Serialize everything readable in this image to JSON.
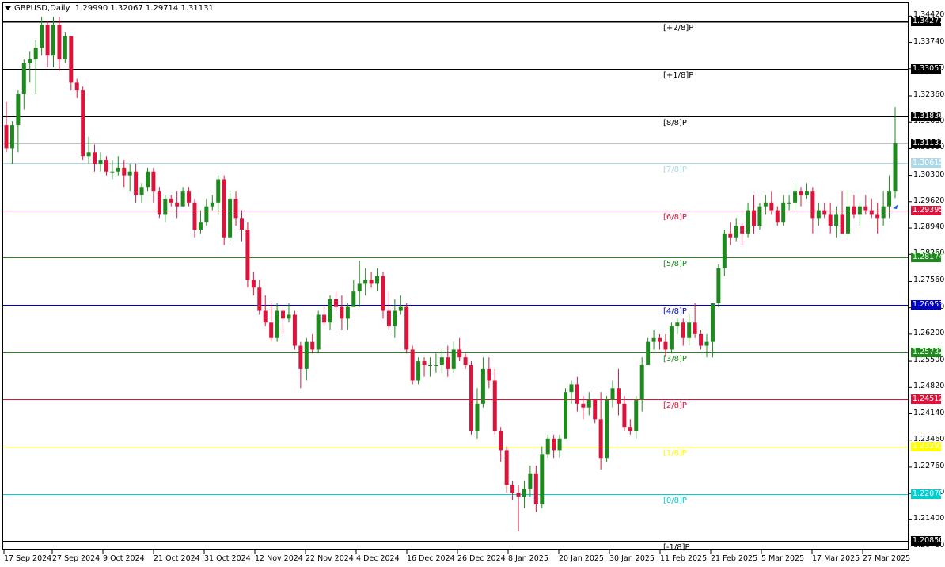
{
  "title": {
    "symbol_text": "GBPUSD,Daily",
    "ohlc_text": "1.29990 1.32067 1.29714 1.31131"
  },
  "colors": {
    "bull": "#1e8a1e",
    "bear": "#dc143c",
    "background": "#ffffff"
  },
  "price_ticks": [
    "1.34420",
    "1.33740",
    "1.33060",
    "1.32360",
    "1.31680",
    "1.31000",
    "1.30300",
    "1.29620",
    "1.28940",
    "1.28260",
    "1.27560",
    "1.26880",
    "1.26200",
    "1.25500",
    "1.24820",
    "1.24140",
    "1.23460",
    "1.22760",
    "1.22080",
    "1.21400",
    "1.20720"
  ],
  "date_ticks": [
    "17 Sep 2024",
    "27 Sep 2024",
    "9 Oct 2024",
    "21 Oct 2024",
    "31 Oct 2024",
    "12 Nov 2024",
    "22 Nov 2024",
    "4 Dec 2024",
    "16 Dec 2024",
    "26 Dec 2024",
    "8 Jan 2025",
    "20 Jan 2025",
    "30 Jan 2025",
    "11 Feb 2025",
    "21 Feb 2025",
    "5 Mar 2025",
    "17 Mar 2025",
    "27 Mar 2025"
  ],
  "levels": [
    {
      "label": "[+2/8]P",
      "price": "1.34277",
      "color": "#000000",
      "box_bg": "#000000",
      "box_fg": "#ffffff",
      "width": 2
    },
    {
      "label": "[+1/8]P",
      "price": "1.33057",
      "color": "#000000",
      "box_bg": "#000000",
      "box_fg": "#ffffff",
      "width": 1
    },
    {
      "label": "[8/8]P",
      "price": "1.31836",
      "color": "#000000",
      "box_bg": "#000000",
      "box_fg": "#ffffff",
      "width": 1
    },
    {
      "label": "[7/8]P",
      "price": "1.30615",
      "color": "#add8e6",
      "box_bg": "#add8e6",
      "box_fg": "#ffffff",
      "width": 1
    },
    {
      "label": "[6/8]P",
      "price": "1.29395",
      "color": "#dc143c",
      "box_bg": "#dc143c",
      "box_fg": "#ffffff",
      "width": 1
    },
    {
      "label": "[5/8]P",
      "price": "1.28174",
      "color": "#1e8a1e",
      "box_bg": "#1e8a1e",
      "box_fg": "#ffffff",
      "width": 1
    },
    {
      "label": "[4/8]P",
      "price": "1.26953",
      "color": "#0000cd",
      "box_bg": "#0000cd",
      "box_fg": "#ffffff",
      "width": 1
    },
    {
      "label": "[3/8]P",
      "price": "1.25732",
      "color": "#1e8a1e",
      "box_bg": "#1e8a1e",
      "box_fg": "#ffffff",
      "width": 1
    },
    {
      "label": "[2/8]P",
      "price": "1.24512",
      "color": "#dc143c",
      "box_bg": "#dc143c",
      "box_fg": "#ffffff",
      "width": 1
    },
    {
      "label": "[1/8]P",
      "price": "1.23291",
      "color": "#ffff00",
      "box_bg": "#ffff00",
      "box_fg": "#ffffff",
      "width": 1
    },
    {
      "label": "[0/8]P",
      "price": "1.22070",
      "color": "#00ced1",
      "box_bg": "#00ced1",
      "box_fg": "#ffffff",
      "width": 1
    },
    {
      "label": "[-1/8]P",
      "price": "1.20850",
      "color": "#000000",
      "box_bg": "#000000",
      "box_fg": "#ffffff",
      "width": 1
    }
  ],
  "current_price": {
    "value": "1.31131",
    "line_color": "#c0c0c0",
    "box_bg": "#000000",
    "box_fg": "#ffffff"
  },
  "chart_data": {
    "type": "candlestick",
    "title": "GBPUSD,Daily",
    "ylim": [
      1.2065,
      1.3455
    ],
    "candles": [
      [
        1.316,
        1.322,
        1.309,
        1.31
      ],
      [
        1.31,
        1.317,
        1.306,
        1.316
      ],
      [
        1.316,
        1.325,
        1.309,
        1.324
      ],
      [
        1.324,
        1.333,
        1.32,
        1.332
      ],
      [
        1.332,
        1.335,
        1.327,
        1.333
      ],
      [
        1.333,
        1.338,
        1.324,
        1.336
      ],
      [
        1.336,
        1.344,
        1.334,
        1.342
      ],
      [
        1.342,
        1.343,
        1.331,
        1.334
      ],
      [
        1.334,
        1.344,
        1.331,
        1.342
      ],
      [
        1.342,
        1.344,
        1.33,
        1.333
      ],
      [
        1.333,
        1.34,
        1.332,
        1.339
      ],
      [
        1.339,
        1.339,
        1.325,
        1.327
      ],
      [
        1.327,
        1.328,
        1.323,
        1.325
      ],
      [
        1.325,
        1.326,
        1.307,
        1.308
      ],
      [
        1.308,
        1.313,
        1.306,
        1.309
      ],
      [
        1.309,
        1.311,
        1.304,
        1.306
      ],
      [
        1.306,
        1.309,
        1.304,
        1.307
      ],
      [
        1.307,
        1.308,
        1.303,
        1.304
      ],
      [
        1.304,
        1.307,
        1.302,
        1.304
      ],
      [
        1.304,
        1.308,
        1.303,
        1.305
      ],
      [
        1.305,
        1.307,
        1.3,
        1.303
      ],
      [
        1.303,
        1.306,
        1.299,
        1.304
      ],
      [
        1.304,
        1.306,
        1.296,
        1.298
      ],
      [
        1.298,
        1.301,
        1.296,
        1.3
      ],
      [
        1.3,
        1.305,
        1.299,
        1.304
      ],
      [
        1.304,
        1.305,
        1.296,
        1.299
      ],
      [
        1.299,
        1.3,
        1.292,
        1.293
      ],
      [
        1.293,
        1.298,
        1.291,
        1.297
      ],
      [
        1.297,
        1.298,
        1.295,
        1.296
      ],
      [
        1.296,
        1.299,
        1.292,
        1.295
      ],
      [
        1.295,
        1.3,
        1.295,
        1.299
      ],
      [
        1.299,
        1.3,
        1.295,
        1.296
      ],
      [
        1.296,
        1.297,
        1.287,
        1.289
      ],
      [
        1.289,
        1.294,
        1.288,
        1.291
      ],
      [
        1.291,
        1.297,
        1.29,
        1.295
      ],
      [
        1.295,
        1.298,
        1.294,
        1.296
      ],
      [
        1.296,
        1.303,
        1.293,
        1.302
      ],
      [
        1.302,
        1.303,
        1.285,
        1.287
      ],
      [
        1.287,
        1.299,
        1.286,
        1.297
      ],
      [
        1.297,
        1.299,
        1.29,
        1.292
      ],
      [
        1.292,
        1.294,
        1.286,
        1.289
      ],
      [
        1.289,
        1.291,
        1.274,
        1.276
      ],
      [
        1.276,
        1.278,
        1.272,
        1.274
      ],
      [
        1.274,
        1.276,
        1.267,
        1.268
      ],
      [
        1.268,
        1.272,
        1.264,
        1.265
      ],
      [
        1.265,
        1.27,
        1.26,
        1.261
      ],
      [
        1.261,
        1.27,
        1.26,
        1.268
      ],
      [
        1.268,
        1.269,
        1.262,
        1.266
      ],
      [
        1.266,
        1.27,
        1.265,
        1.267
      ],
      [
        1.267,
        1.268,
        1.258,
        1.259
      ],
      [
        1.259,
        1.26,
        1.248,
        1.253
      ],
      [
        1.253,
        1.261,
        1.25,
        1.26
      ],
      [
        1.26,
        1.262,
        1.257,
        1.258
      ],
      [
        1.258,
        1.268,
        1.257,
        1.267
      ],
      [
        1.267,
        1.269,
        1.264,
        1.265
      ],
      [
        1.265,
        1.272,
        1.263,
        1.271
      ],
      [
        1.271,
        1.273,
        1.268,
        1.269
      ],
      [
        1.269,
        1.272,
        1.263,
        1.266
      ],
      [
        1.266,
        1.27,
        1.263,
        1.269
      ],
      [
        1.269,
        1.276,
        1.269,
        1.273
      ],
      [
        1.273,
        1.281,
        1.269,
        1.275
      ],
      [
        1.275,
        1.279,
        1.272,
        1.276
      ],
      [
        1.276,
        1.278,
        1.274,
        1.275
      ],
      [
        1.275,
        1.279,
        1.273,
        1.277
      ],
      [
        1.277,
        1.278,
        1.266,
        1.268
      ],
      [
        1.268,
        1.273,
        1.263,
        1.264
      ],
      [
        1.264,
        1.271,
        1.261,
        1.268
      ],
      [
        1.268,
        1.272,
        1.267,
        1.269
      ],
      [
        1.269,
        1.27,
        1.257,
        1.258
      ],
      [
        1.258,
        1.259,
        1.249,
        1.25
      ],
      [
        1.25,
        1.256,
        1.249,
        1.255
      ],
      [
        1.255,
        1.256,
        1.251,
        1.254
      ],
      [
        1.254,
        1.256,
        1.251,
        1.254
      ],
      [
        1.254,
        1.257,
        1.252,
        1.254
      ],
      [
        1.254,
        1.258,
        1.252,
        1.256
      ],
      [
        1.256,
        1.259,
        1.251,
        1.253
      ],
      [
        1.253,
        1.26,
        1.252,
        1.258
      ],
      [
        1.258,
        1.261,
        1.255,
        1.256
      ],
      [
        1.256,
        1.257,
        1.253,
        1.254
      ],
      [
        1.254,
        1.255,
        1.236,
        1.237
      ],
      [
        1.237,
        1.248,
        1.235,
        1.244
      ],
      [
        1.244,
        1.256,
        1.243,
        1.253
      ],
      [
        1.253,
        1.256,
        1.248,
        1.25
      ],
      [
        1.25,
        1.253,
        1.236,
        1.237
      ],
      [
        1.237,
        1.238,
        1.229,
        1.232
      ],
      [
        1.232,
        1.233,
        1.221,
        1.223
      ],
      [
        1.223,
        1.224,
        1.219,
        1.221
      ],
      [
        1.221,
        1.223,
        1.211,
        1.22
      ],
      [
        1.22,
        1.224,
        1.217,
        1.222
      ],
      [
        1.222,
        1.228,
        1.22,
        1.226
      ],
      [
        1.226,
        1.228,
        1.216,
        1.218
      ],
      [
        1.218,
        1.233,
        1.217,
        1.231
      ],
      [
        1.231,
        1.236,
        1.23,
        1.235
      ],
      [
        1.235,
        1.236,
        1.23,
        1.232
      ],
      [
        1.232,
        1.236,
        1.23,
        1.235
      ],
      [
        1.235,
        1.248,
        1.235,
        1.247
      ],
      [
        1.247,
        1.25,
        1.244,
        1.249
      ],
      [
        1.249,
        1.251,
        1.242,
        1.244
      ],
      [
        1.244,
        1.246,
        1.24,
        1.243
      ],
      [
        1.243,
        1.247,
        1.241,
        1.245
      ],
      [
        1.245,
        1.245,
        1.239,
        1.24
      ],
      [
        1.24,
        1.247,
        1.227,
        1.23
      ],
      [
        1.23,
        1.246,
        1.229,
        1.245
      ],
      [
        1.245,
        1.25,
        1.243,
        1.248
      ],
      [
        1.248,
        1.253,
        1.241,
        1.244
      ],
      [
        1.244,
        1.246,
        1.237,
        1.238
      ],
      [
        1.238,
        1.24,
        1.236,
        1.237
      ],
      [
        1.237,
        1.246,
        1.235,
        1.245
      ],
      [
        1.245,
        1.256,
        1.242,
        1.254
      ],
      [
        1.254,
        1.261,
        1.254,
        1.26
      ],
      [
        1.26,
        1.263,
        1.258,
        1.261
      ],
      [
        1.261,
        1.262,
        1.258,
        1.26
      ],
      [
        1.26,
        1.262,
        1.256,
        1.258
      ],
      [
        1.258,
        1.265,
        1.257,
        1.264
      ],
      [
        1.264,
        1.266,
        1.262,
        1.265
      ],
      [
        1.265,
        1.266,
        1.259,
        1.261
      ],
      [
        1.261,
        1.267,
        1.259,
        1.265
      ],
      [
        1.265,
        1.27,
        1.261,
        1.262
      ],
      [
        1.262,
        1.263,
        1.258,
        1.259
      ],
      [
        1.259,
        1.262,
        1.256,
        1.26
      ],
      [
        1.26,
        1.27,
        1.256,
        1.27
      ],
      [
        1.27,
        1.28,
        1.269,
        1.279
      ],
      [
        1.279,
        1.289,
        1.277,
        1.288
      ],
      [
        1.288,
        1.291,
        1.285,
        1.287
      ],
      [
        1.287,
        1.292,
        1.286,
        1.29
      ],
      [
        1.29,
        1.291,
        1.285,
        1.288
      ],
      [
        1.288,
        1.296,
        1.287,
        1.294
      ],
      [
        1.294,
        1.298,
        1.288,
        1.29
      ],
      [
        1.29,
        1.296,
        1.289,
        1.295
      ],
      [
        1.295,
        1.298,
        1.293,
        1.296
      ],
      [
        1.296,
        1.299,
        1.293,
        1.294
      ],
      [
        1.294,
        1.295,
        1.29,
        1.291
      ],
      [
        1.291,
        1.298,
        1.29,
        1.296
      ],
      [
        1.296,
        1.298,
        1.294,
        1.296
      ],
      [
        1.296,
        1.301,
        1.294,
        1.299
      ],
      [
        1.299,
        1.3,
        1.295,
        1.298
      ],
      [
        1.298,
        1.301,
        1.297,
        1.299
      ],
      [
        1.299,
        1.3,
        1.288,
        1.292
      ],
      [
        1.292,
        1.296,
        1.29,
        1.294
      ],
      [
        1.294,
        1.296,
        1.292,
        1.293
      ],
      [
        1.293,
        1.296,
        1.288,
        1.29
      ],
      [
        1.29,
        1.295,
        1.287,
        1.293
      ],
      [
        1.293,
        1.299,
        1.288,
        1.288
      ],
      [
        1.288,
        1.299,
        1.287,
        1.295
      ],
      [
        1.295,
        1.298,
        1.292,
        1.293
      ],
      [
        1.293,
        1.296,
        1.29,
        1.295
      ],
      [
        1.295,
        1.298,
        1.293,
        1.294
      ],
      [
        1.294,
        1.297,
        1.292,
        1.293
      ],
      [
        1.293,
        1.296,
        1.288,
        1.292
      ],
      [
        1.292,
        1.299,
        1.29,
        1.295
      ],
      [
        1.295,
        1.303,
        1.292,
        1.299
      ],
      [
        1.299,
        1.3207,
        1.2971,
        1.3113
      ]
    ]
  }
}
